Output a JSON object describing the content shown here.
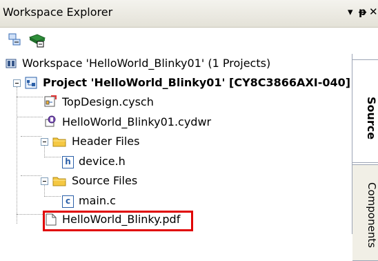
{
  "panel": {
    "title": "Workspace Explorer",
    "dropdown_glyph": "▾",
    "pin_glyph": "ᵽ",
    "close_glyph": "✕"
  },
  "toolbar": {
    "buttons": [
      {
        "icon": "collapse-all-icon"
      },
      {
        "icon": "chip-icon"
      }
    ]
  },
  "tree": {
    "workspace": "Workspace 'HelloWorld_Blinky01' (1 Projects)",
    "project": "Project 'HelloWorld_Blinky01' [CY8C3866AXI-040]",
    "items": [
      {
        "label": "TopDesign.cysch",
        "icon": "schematic-icon"
      },
      {
        "label": "HelloWorld_Blinky01.cydwr",
        "icon": "design-wide-resources-icon"
      },
      {
        "label": "Header Files",
        "icon": "folder-icon"
      },
      {
        "label": "device.h",
        "icon": "header-file-icon"
      },
      {
        "label": "Source Files",
        "icon": "folder-icon"
      },
      {
        "label": "main.c",
        "icon": "c-file-icon"
      },
      {
        "label": "HelloWorld_Blinky.pdf",
        "icon": "document-icon"
      }
    ],
    "header_file_glyph": "h",
    "c_file_glyph": "c"
  },
  "side_tabs": [
    {
      "label": "Source",
      "active": true
    },
    {
      "label": "Components",
      "active": false
    }
  ],
  "colors": {
    "highlight": "#e00000",
    "folder": "#f5c842"
  }
}
